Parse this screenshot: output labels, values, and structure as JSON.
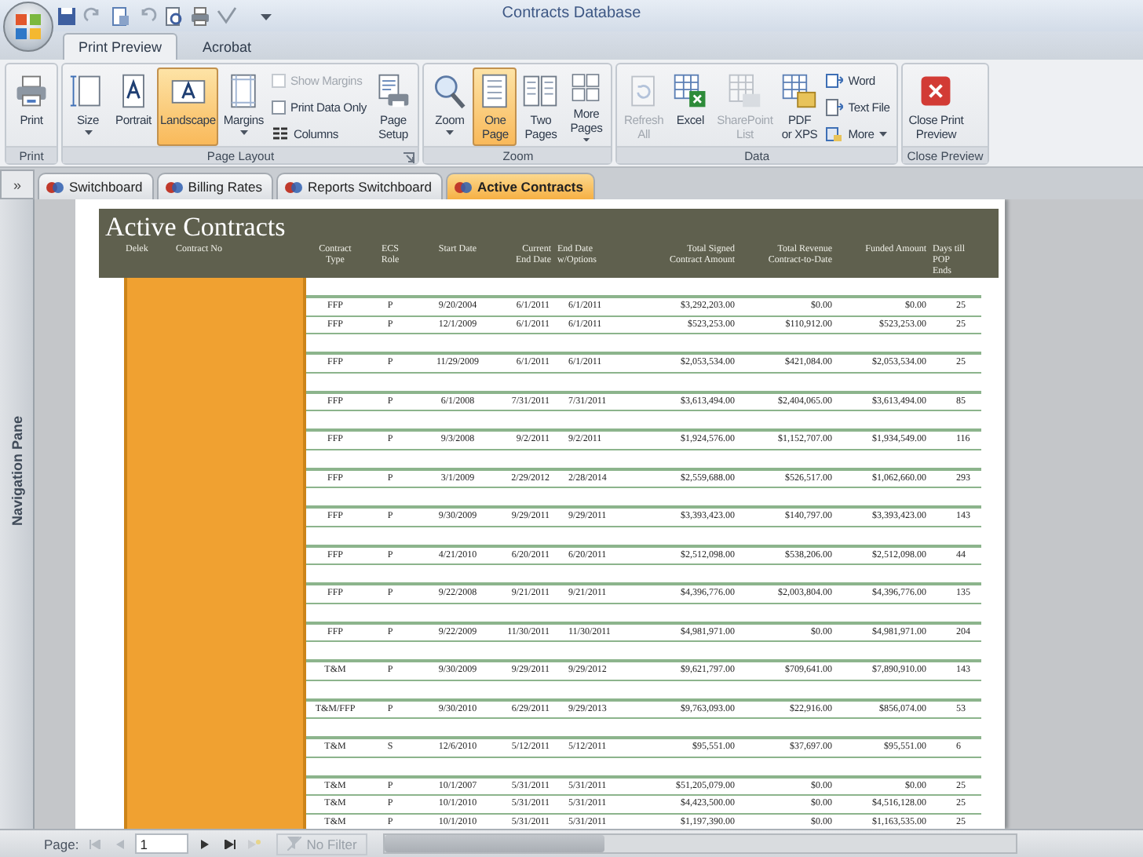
{
  "title_bar": {
    "title": "Contracts Database"
  },
  "ribbon_tabs": [
    {
      "label": "Print Preview",
      "selected": true
    },
    {
      "label": "Acrobat",
      "selected": false
    }
  ],
  "ribbon_groups": [
    {
      "label": "Print",
      "launcher": false,
      "items": [
        {
          "kind": "large",
          "label": "Print",
          "selected": false,
          "disabled": false,
          "dropdown": false
        }
      ]
    },
    {
      "label": "Page Layout",
      "launcher": true,
      "items": [
        {
          "kind": "large",
          "label": "Size",
          "selected": false,
          "disabled": false,
          "dropdown": true
        },
        {
          "kind": "large",
          "label": "Portrait",
          "selected": false,
          "disabled": false,
          "dropdown": false
        },
        {
          "kind": "large",
          "label": "Landscape",
          "selected": true,
          "disabled": false,
          "dropdown": false
        },
        {
          "kind": "large",
          "label": "Margins",
          "selected": false,
          "disabled": false,
          "dropdown": true
        },
        {
          "kind": "stack",
          "items": [
            {
              "kind": "check",
              "label": "Show Margins",
              "checked": false,
              "disabled": true
            },
            {
              "kind": "check",
              "label": "Print Data Only",
              "checked": false,
              "disabled": false
            },
            {
              "kind": "small",
              "label": "Columns",
              "disabled": false,
              "dropdown": false
            }
          ]
        },
        {
          "kind": "large",
          "label": "Page\nSetup",
          "selected": false,
          "disabled": false,
          "dropdown": false
        }
      ]
    },
    {
      "label": "Zoom",
      "launcher": false,
      "items": [
        {
          "kind": "large",
          "label": "Zoom",
          "selected": false,
          "disabled": false,
          "dropdown": true
        },
        {
          "kind": "large",
          "label": "One\nPage",
          "selected": true,
          "disabled": false,
          "dropdown": false
        },
        {
          "kind": "large",
          "label": "Two\nPages",
          "selected": false,
          "disabled": false,
          "dropdown": false
        },
        {
          "kind": "large",
          "label": "More\nPages",
          "selected": false,
          "disabled": false,
          "dropdown": true
        }
      ]
    },
    {
      "label": "Data",
      "launcher": false,
      "items": [
        {
          "kind": "large",
          "label": "Refresh\nAll",
          "selected": false,
          "disabled": true,
          "dropdown": false
        },
        {
          "kind": "large",
          "label": "Excel",
          "selected": false,
          "disabled": false,
          "dropdown": false
        },
        {
          "kind": "large",
          "label": "SharePoint\nList",
          "selected": false,
          "disabled": true,
          "dropdown": false
        },
        {
          "kind": "large",
          "label": "PDF\nor XPS",
          "selected": false,
          "disabled": false,
          "dropdown": false
        },
        {
          "kind": "stack",
          "items": [
            {
              "kind": "small",
              "label": "Word",
              "disabled": false,
              "dropdown": false
            },
            {
              "kind": "small",
              "label": "Text File",
              "disabled": false,
              "dropdown": false
            },
            {
              "kind": "small",
              "label": "More",
              "disabled": false,
              "dropdown": true
            }
          ]
        }
      ]
    },
    {
      "label": "Close Preview",
      "launcher": false,
      "items": [
        {
          "kind": "large",
          "label": "Close Print\nPreview",
          "selected": false,
          "disabled": false,
          "dropdown": false
        }
      ]
    }
  ],
  "pane_toggle": "»",
  "document_tabs": [
    {
      "label": "Switchboard",
      "selected": false
    },
    {
      "label": "Billing Rates",
      "selected": false
    },
    {
      "label": "Reports Switchboard",
      "selected": false
    },
    {
      "label": "Active Contracts",
      "selected": true
    }
  ],
  "navigation_pane": {
    "label": "Navigation Pane"
  },
  "report": {
    "title": "Active Contracts",
    "columns": [
      "Delek",
      "Contract No",
      "Contract\nType",
      "ECS\nRole",
      "Start Date",
      "Current\nEnd Date",
      "End Date\nw/Options",
      "Total Signed\nContract Amount",
      "Total Revenue\nContract-to-Date",
      "Funded Amount",
      "Days till\nPOP\nEnds"
    ],
    "groups": [
      {
        "rows": [
          {
            "cells": [
              "FFP",
              "P",
              "9/20/2004",
              "6/1/2011",
              "6/1/2011",
              "$3,292,203.00",
              "$0.00",
              "$0.00",
              "25"
            ]
          },
          {
            "cells": [
              "FFP",
              "P",
              "12/1/2009",
              "6/1/2011",
              "6/1/2011",
              "$523,253.00",
              "$110,912.00",
              "$523,253.00",
              "25"
            ]
          }
        ]
      },
      {
        "rows": [
          {
            "cells": [
              "FFP",
              "P",
              "11/29/2009",
              "6/1/2011",
              "6/1/2011",
              "$2,053,534.00",
              "$421,084.00",
              "$2,053,534.00",
              "25"
            ]
          }
        ]
      },
      {
        "rows": [
          {
            "cells": [
              "FFP",
              "P",
              "6/1/2008",
              "7/31/2011",
              "7/31/2011",
              "$3,613,494.00",
              "$2,404,065.00",
              "$3,613,494.00",
              "85"
            ]
          }
        ]
      },
      {
        "rows": [
          {
            "cells": [
              "FFP",
              "P",
              "9/3/2008",
              "9/2/2011",
              "9/2/2011",
              "$1,924,576.00",
              "$1,152,707.00",
              "$1,934,549.00",
              "116"
            ]
          }
        ]
      },
      {
        "rows": [
          {
            "cells": [
              "FFP",
              "P",
              "3/1/2009",
              "2/29/2012",
              "2/28/2014",
              "$2,559,688.00",
              "$526,517.00",
              "$1,062,660.00",
              "293"
            ]
          }
        ]
      },
      {
        "rows": [
          {
            "cells": [
              "FFP",
              "P",
              "9/30/2009",
              "9/29/2011",
              "9/29/2011",
              "$3,393,423.00",
              "$140,797.00",
              "$3,393,423.00",
              "143"
            ]
          }
        ]
      },
      {
        "rows": [
          {
            "cells": [
              "FFP",
              "P",
              "4/21/2010",
              "6/20/2011",
              "6/20/2011",
              "$2,512,098.00",
              "$538,206.00",
              "$2,512,098.00",
              "44"
            ]
          }
        ]
      },
      {
        "rows": [
          {
            "cells": [
              "FFP",
              "P",
              "9/22/2008",
              "9/21/2011",
              "9/21/2011",
              "$4,396,776.00",
              "$2,003,804.00",
              "$4,396,776.00",
              "135"
            ]
          }
        ]
      },
      {
        "rows": [
          {
            "cells": [
              "FFP",
              "P",
              "9/22/2009",
              "11/30/2011",
              "11/30/2011",
              "$4,981,971.00",
              "$0.00",
              "$4,981,971.00",
              "204"
            ]
          }
        ]
      },
      {
        "rows": [
          {
            "cells": [
              "T&M",
              "P",
              "9/30/2009",
              "9/29/2011",
              "9/29/2012",
              "$9,621,797.00",
              "$709,641.00",
              "$7,890,910.00",
              "143"
            ]
          }
        ]
      },
      {
        "rows": [
          {
            "cells": [
              "T&M/FFP",
              "P",
              "9/30/2010",
              "6/29/2011",
              "9/29/2013",
              "$9,763,093.00",
              "$22,916.00",
              "$856,074.00",
              "53"
            ]
          }
        ]
      },
      {
        "rows": [
          {
            "cells": [
              "T&M",
              "S",
              "12/6/2010",
              "5/12/2011",
              "5/12/2011",
              "$95,551.00",
              "$37,697.00",
              "$95,551.00",
              "6"
            ]
          }
        ]
      },
      {
        "rows": [
          {
            "cells": [
              "T&M",
              "P",
              "10/1/2007",
              "5/31/2011",
              "5/31/2011",
              "$51,205,079.00",
              "$0.00",
              "$0.00",
              "25"
            ]
          },
          {
            "cells": [
              "T&M",
              "P",
              "10/1/2010",
              "5/31/2011",
              "5/31/2011",
              "$4,423,500.00",
              "$0.00",
              "$4,516,128.00",
              "25"
            ]
          },
          {
            "cells": [
              "T&M",
              "P",
              "10/1/2010",
              "5/31/2011",
              "5/31/2011",
              "$1,197,390.00",
              "$0.00",
              "$1,163,535.00",
              "25"
            ]
          }
        ]
      }
    ]
  },
  "status_bar": {
    "page_label": "Page:",
    "page_value": "1",
    "filter": {
      "label": "No Filter",
      "disabled": true
    }
  }
}
